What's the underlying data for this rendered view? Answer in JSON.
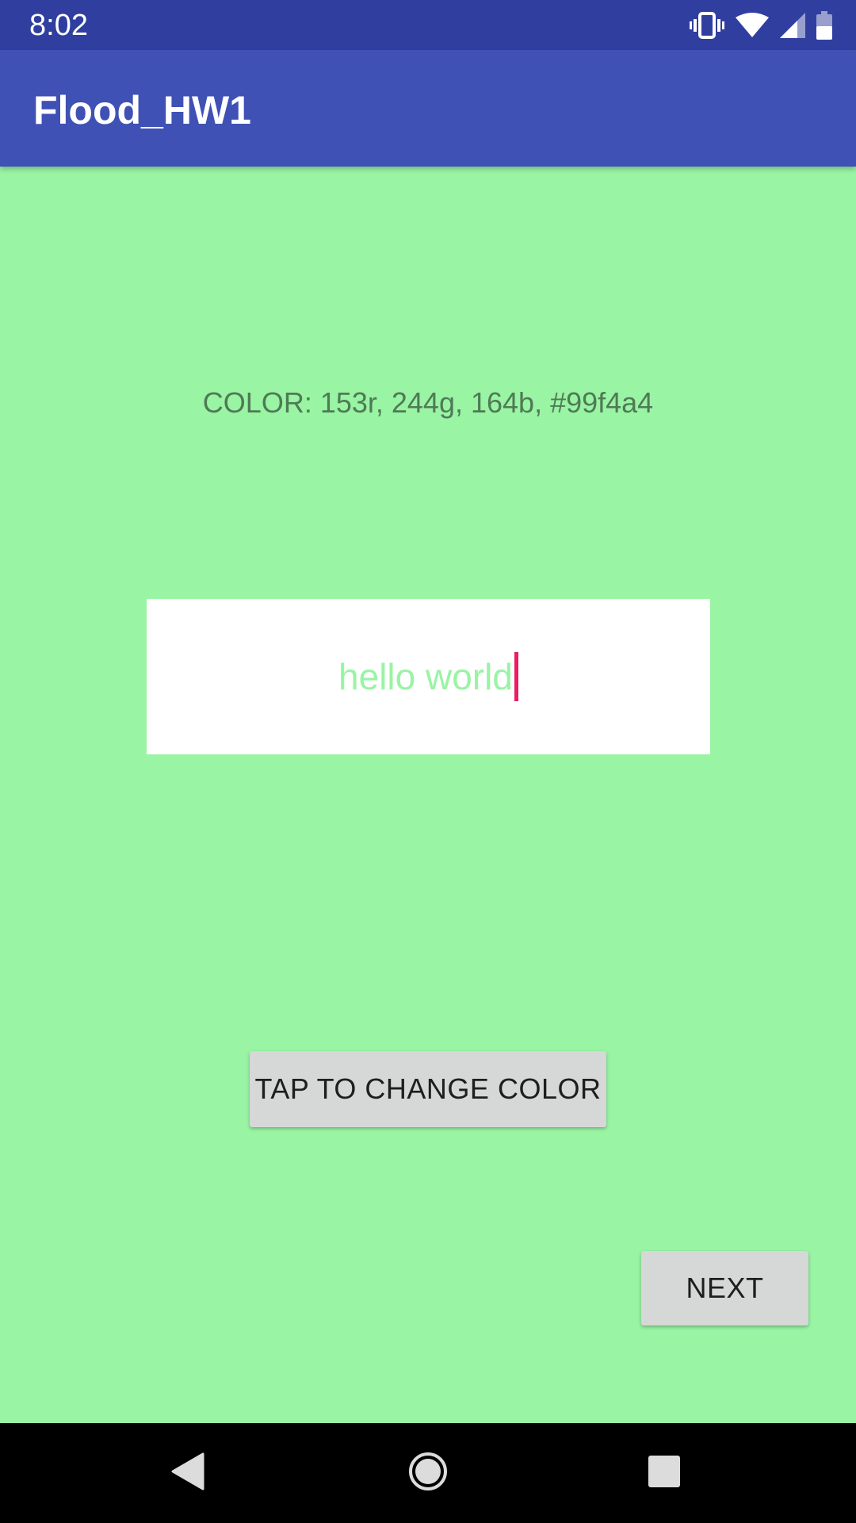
{
  "status_bar": {
    "time": "8:02",
    "icons": [
      "vibrate-icon",
      "wifi-icon",
      "signal-icon",
      "battery-icon"
    ]
  },
  "app_bar": {
    "title": "Flood_HW1"
  },
  "main": {
    "color_label": "COLOR: 153r, 244g, 164b, #99f4a4",
    "text_field_value": "hello world",
    "change_color_button": "TAP TO CHANGE COLOR",
    "next_button": "NEXT"
  },
  "nav_bar": {
    "icons": [
      "back-icon",
      "home-icon",
      "recents-icon"
    ]
  },
  "colors": {
    "background": "#99f4a4",
    "status_bar": "#303f9f",
    "app_bar": "#3f51b5",
    "caret": "#e91e63",
    "button": "#d6d7d7"
  }
}
